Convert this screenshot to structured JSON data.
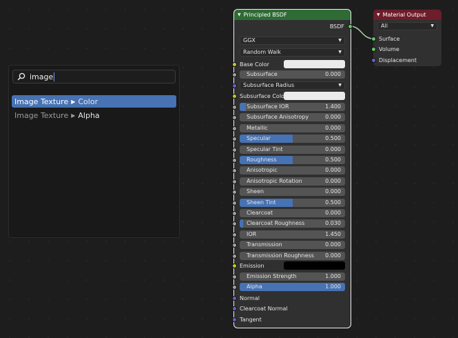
{
  "search": {
    "query": "image",
    "results": [
      {
        "name": "Image Texture",
        "sub": "Color",
        "active": true
      },
      {
        "name": "Image Texture",
        "sub": "Alpha",
        "active": false
      }
    ]
  },
  "bsdf": {
    "title": "Principled BSDF",
    "output_label": "BSDF",
    "distribution": "GGX",
    "subsurface_method": "Random Walk",
    "base_color_label": "Base Color",
    "base_color": "#ebebeb",
    "subsurface": {
      "label": "Subsurface",
      "value": "0.000"
    },
    "subsurface_radius": "Subsurface Radius",
    "subsurface_color_label": "Subsurface Color",
    "subsurface_color": "#ebebeb",
    "fields": [
      {
        "label": "Subsurface IOR",
        "value": "1.400",
        "fill": 0.06
      },
      {
        "label": "Subsurface Anisotropy",
        "value": "0.000",
        "fill": 0
      },
      {
        "label": "Metallic",
        "value": "0.000",
        "fill": 0
      },
      {
        "label": "Specular",
        "value": "0.500",
        "fill": 0.5
      },
      {
        "label": "Specular Tint",
        "value": "0.000",
        "fill": 0
      },
      {
        "label": "Roughness",
        "value": "0.500",
        "fill": 0.5
      },
      {
        "label": "Anisotropic",
        "value": "0.000",
        "fill": 0
      },
      {
        "label": "Anisotropic Rotation",
        "value": "0.000",
        "fill": 0
      },
      {
        "label": "Sheen",
        "value": "0.000",
        "fill": 0
      },
      {
        "label": "Sheen Tint",
        "value": "0.500",
        "fill": 0.5
      },
      {
        "label": "Clearcoat",
        "value": "0.000",
        "fill": 0
      },
      {
        "label": "Clearcoat Roughness",
        "value": "0.030",
        "fill": 0.03
      },
      {
        "label": "IOR",
        "value": "1.450",
        "fill": 0
      },
      {
        "label": "Transmission",
        "value": "0.000",
        "fill": 0
      },
      {
        "label": "Transmission Roughness",
        "value": "0.000",
        "fill": 0
      }
    ],
    "emission_label": "Emission",
    "emission_color": "#000000",
    "emission_strength": {
      "label": "Emission Strength",
      "value": "1.000",
      "fill": 0
    },
    "alpha": {
      "label": "Alpha",
      "value": "1.000",
      "fill": 1
    },
    "normal_label": "Normal",
    "clearcoat_normal_label": "Clearcoat Normal",
    "tangent_label": "Tangent"
  },
  "material_output": {
    "title": "Material Output",
    "target": "All",
    "inputs": [
      "Surface",
      "Volume",
      "Displacement"
    ]
  }
}
